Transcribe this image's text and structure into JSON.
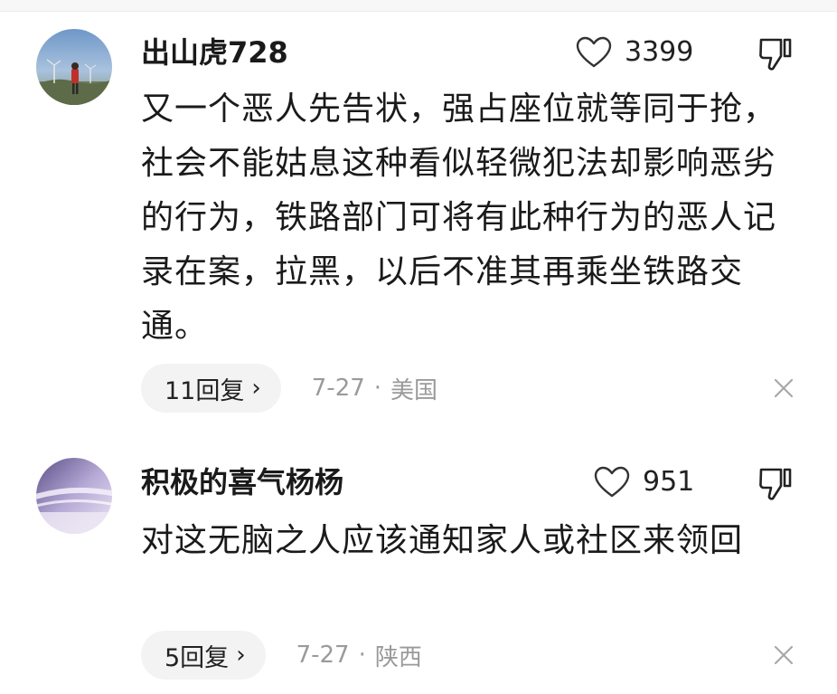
{
  "comments": [
    {
      "username": "出山虎728",
      "likes": "3399",
      "text": "又一个恶人先告状，强占座位就等同于抢，社会不能姑息这种看似轻微犯法却影响恶劣的行为，铁路部门可将有此种行为的恶人记录在案，拉黑，以后不准其再乘坐铁路交通。",
      "reply_label": "11回复",
      "date": "7-27",
      "location": "美国",
      "icons": {
        "avatar": "avatar-photo",
        "like": "heart-outline-icon",
        "dislike": "thumbs-down-icon",
        "close": "close-icon"
      }
    },
    {
      "username": "积极的喜气杨杨",
      "likes": "951",
      "text": "对这无脑之人应该通知家人或社区来领回",
      "reply_label": "5回复",
      "date": "7-27",
      "location": "陕西",
      "icons": {
        "avatar": "avatar-photo",
        "like": "heart-outline-icon",
        "dislike": "thumbs-down-icon",
        "close": "close-icon"
      }
    }
  ],
  "separator": "·",
  "chevron": "›"
}
